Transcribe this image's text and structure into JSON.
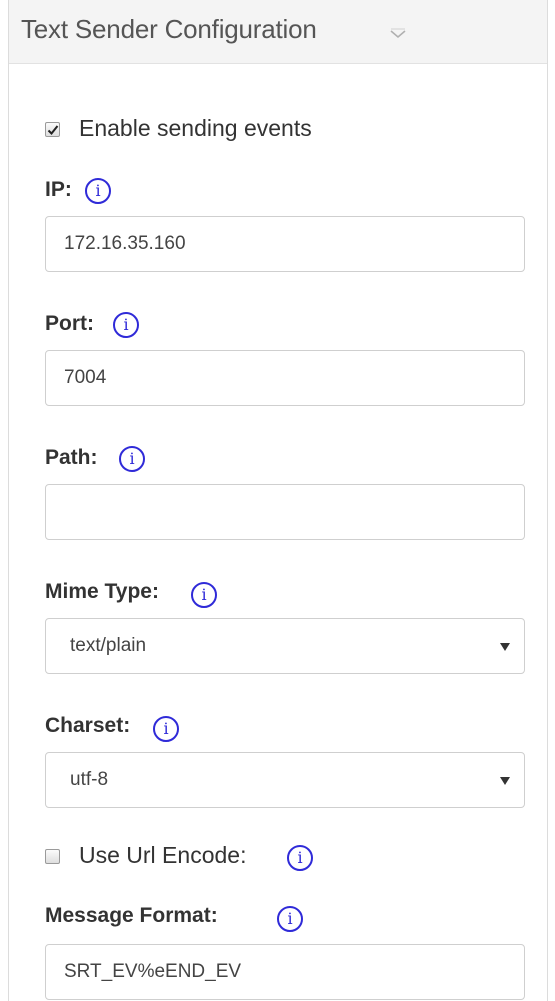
{
  "header": {
    "title": "Text Sender Configuration",
    "collapse_icon": "chevron-down-icon"
  },
  "enable_sending": {
    "label": "Enable sending events",
    "checked": true
  },
  "ip": {
    "label": "IP:",
    "value": "172.16.35.160",
    "info_icon": "info-icon"
  },
  "port": {
    "label": "Port:",
    "value": "7004",
    "info_icon": "info-icon"
  },
  "path": {
    "label": "Path:",
    "value": "",
    "info_icon": "info-icon"
  },
  "mime_type": {
    "label": "Mime Type:",
    "selected": "text/plain",
    "info_icon": "info-icon"
  },
  "charset": {
    "label": "Charset:",
    "selected": "utf-8",
    "info_icon": "info-icon"
  },
  "url_encode": {
    "label": "Use Url Encode:",
    "checked": false,
    "info_icon": "info-icon"
  },
  "message_format": {
    "label": "Message Format:",
    "value": "SRT_EV%eEND_EV",
    "info_icon": "info-icon"
  },
  "icons": {
    "info_glyph": "i"
  },
  "colors": {
    "info_icon": "#2f2ad8",
    "header_background": "#f4f4f4",
    "input_border": "#cfcfcf"
  }
}
